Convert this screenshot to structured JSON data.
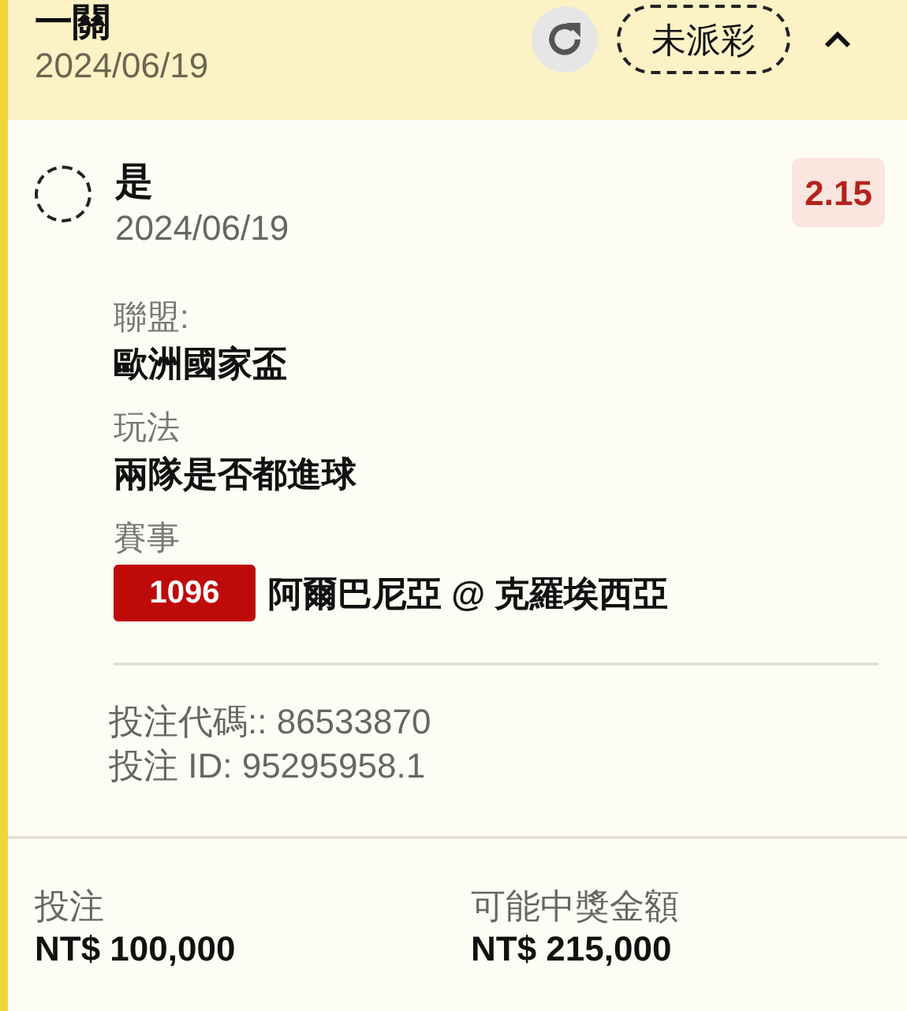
{
  "header": {
    "title": "一關",
    "date": "2024/06/19",
    "status": "未派彩",
    "expanded": true
  },
  "selection": {
    "name": "是",
    "date": "2024/06/19",
    "odds": "2.15",
    "checked": false
  },
  "details": [
    {
      "kind": "text",
      "label": "聯盟:",
      "value": "歐洲國家盃"
    },
    {
      "kind": "text",
      "label": "玩法",
      "value": "兩隊是否都進球"
    },
    {
      "kind": "match",
      "label": "賽事",
      "code": "1096",
      "value": "阿爾巴尼亞 @ 克羅埃西亞"
    }
  ],
  "bet_code": "投注代碼:: 86533870",
  "bet_id": "投注 ID: 95295958.1",
  "footer": [
    {
      "label": "投注",
      "value": "NT$ 100,000"
    },
    {
      "label": "可能中獎金額",
      "value": "NT$ 215,000"
    }
  ]
}
